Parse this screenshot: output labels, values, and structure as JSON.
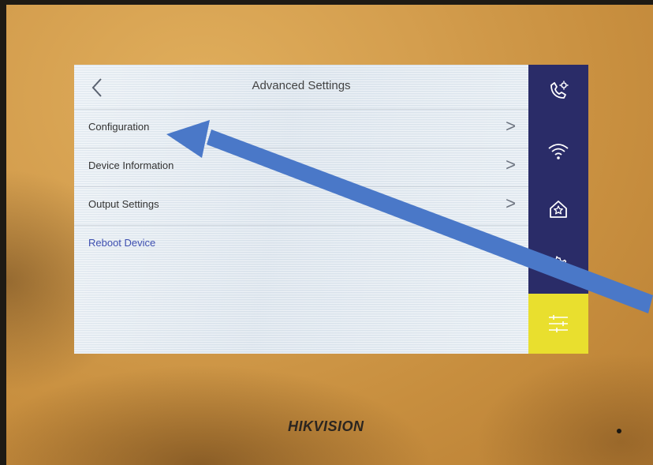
{
  "screen": {
    "title": "Advanced Settings",
    "back_icon": "chevron-left-icon",
    "menu": [
      {
        "label": "Configuration",
        "chevron": ">"
      },
      {
        "label": "Device Information",
        "chevron": ">"
      },
      {
        "label": "Output Settings",
        "chevron": ">"
      },
      {
        "label": "Reboot Device",
        "chevron": ""
      }
    ]
  },
  "sidebar": {
    "items": [
      {
        "icon": "phone-settings-icon"
      },
      {
        "icon": "wifi-icon"
      },
      {
        "icon": "home-icon"
      },
      {
        "icon": "gear-icon"
      },
      {
        "icon": "sliders-icon",
        "active": true
      }
    ],
    "colors": {
      "background": "#2a2c68",
      "active": "#e9df2e"
    }
  },
  "device": {
    "brand": "HIKVISION"
  },
  "annotation": {
    "arrow_color": "#4a78c8",
    "points_to": "Configuration"
  }
}
